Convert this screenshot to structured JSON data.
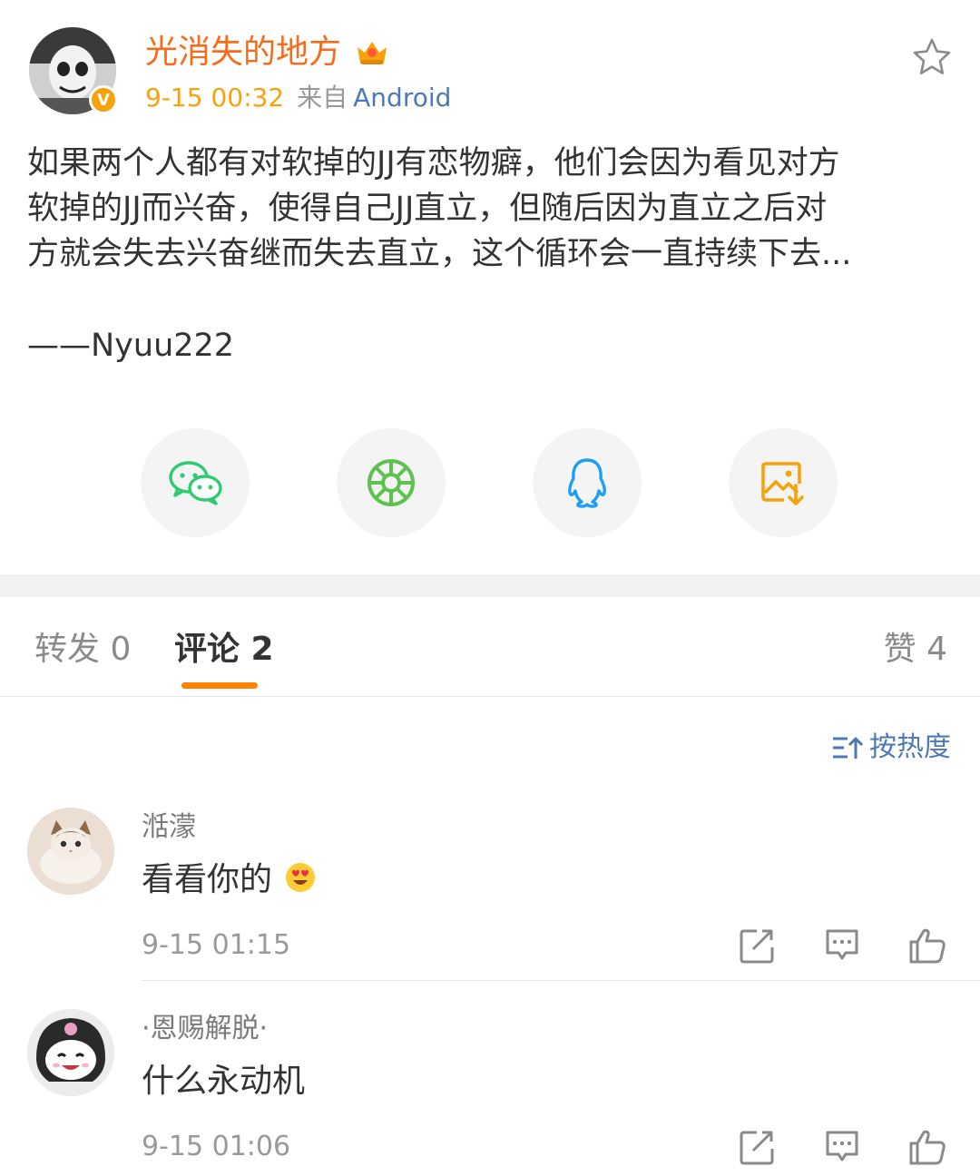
{
  "post": {
    "author": "光消失的地方",
    "verified_badge": "V",
    "time": "9-15 00:32",
    "from_label": "来自",
    "source": "Android",
    "body_lines": [
      "如果两个人都有对软掉的JJ有恋物癖，他们会因为看见对方",
      "软掉的JJ而兴奋，使得自己JJ直立，但随后因为直立之后对",
      "方就会失去兴奋继而失去直立，这个循环会一直持续下去..."
    ],
    "signature": "——Nyuu222"
  },
  "share": {
    "icons": [
      "wechat-icon",
      "moments-icon",
      "qq-icon",
      "save-image-icon"
    ]
  },
  "tabs": {
    "repost": "转发 0",
    "comments": "评论 2",
    "likes": "赞 4"
  },
  "sort": {
    "label": "按热度"
  },
  "comments": [
    {
      "user": "湉濛",
      "text": "看看你的",
      "emoji": "heart-eyes-emoji",
      "time": "9-15 01:15"
    },
    {
      "user": "·恩赐解脱·",
      "text": "什么永动机",
      "time": "9-15 01:06"
    }
  ],
  "colors": {
    "author": "#f76c1b",
    "time": "#f7a20a",
    "link": "#4d7ab6",
    "tab_indicator": "#ff8200",
    "wechat": "#2ecb71",
    "moments": "#5ec24f",
    "qq": "#1e9ff2",
    "save": "#f7a20a"
  }
}
